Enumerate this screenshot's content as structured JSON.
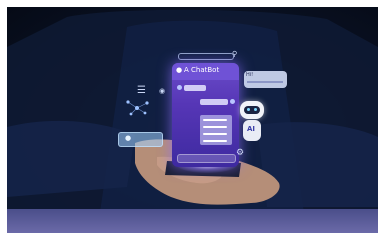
{
  "photo": {
    "phone_title": "A ChatBot",
    "bubble_greeting": "Hi!",
    "robot_label": "AI",
    "icons": [
      "chatbot-icon",
      "search-icon",
      "robot-icon",
      "server-stack-icon",
      "network-icon",
      "gear-icon",
      "user-card-icon",
      "location-pin-icon"
    ],
    "colors": {
      "background": "#0c1428",
      "phone_screen": "#5636b6",
      "phone_glow": "#8c6eff",
      "bottom_bar": "#5c5b9a"
    }
  }
}
